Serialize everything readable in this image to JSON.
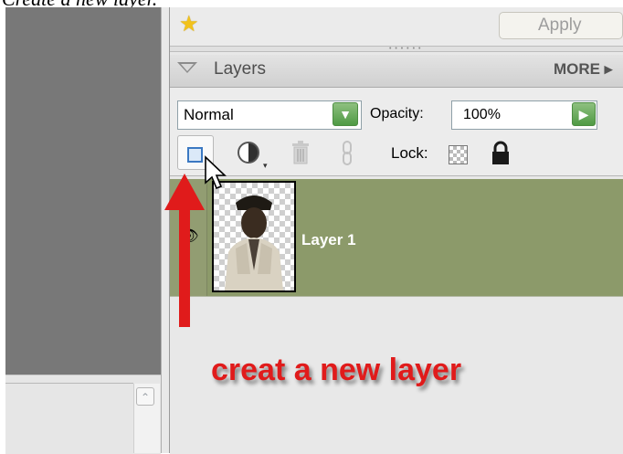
{
  "caption": "Create a new layer.",
  "toolbar": {
    "apply_label": "Apply"
  },
  "layers_panel": {
    "title": "Layers",
    "more_label": "MORE ▸",
    "blend_mode": "Normal",
    "opacity_label": "Opacity:",
    "opacity_value": "100%",
    "lock_label": "Lock:"
  },
  "layers": [
    {
      "name": "Layer 1",
      "visible": true,
      "selected": true
    }
  ],
  "annotation": {
    "text": "creat a new layer",
    "color": "#e01b1b"
  },
  "colors": {
    "selected_layer_bg": "#8c9a6a",
    "canvas_bg": "#787878",
    "arrow": "#e01b1b"
  },
  "icons": [
    "star-icon",
    "collapse-triangle-icon",
    "new-layer-icon",
    "adjust-icon",
    "trash-icon",
    "link-icon",
    "lock-transparency-icon",
    "lock-all-icon",
    "eye-icon",
    "cursor-icon"
  ]
}
